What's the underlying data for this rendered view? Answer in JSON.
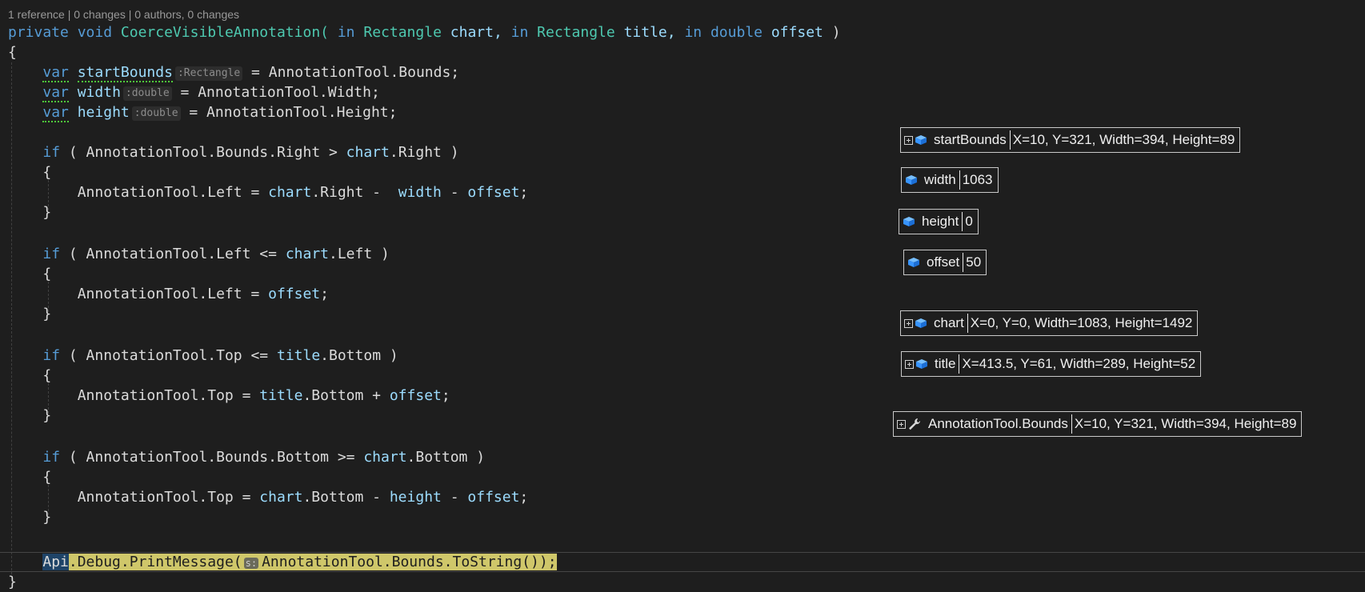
{
  "codelens": "1 reference | 0 changes | 0 authors, 0 changes",
  "code": {
    "sig_private": "private",
    "sig_void": "void",
    "sig_name": "CoerceVisibleAnnotation(",
    "sig_in1": "in",
    "sig_type1": "Rectangle",
    "sig_p1": "chart,",
    "sig_in2": "in",
    "sig_type2": "Rectangle",
    "sig_p2": "title,",
    "sig_in3": "in",
    "sig_type3": "double",
    "sig_p3": "offset",
    "sig_close": ")",
    "brace_open": "{",
    "brace_close": "}",
    "var": "var",
    "v1_name": "startBounds",
    "v1_hint": ":Rectangle",
    "v1_rhs": " = AnnotationTool.Bounds;",
    "v2_name": "width",
    "v2_hint": ":double",
    "v2_rhs": " = AnnotationTool.Width;",
    "v3_name": "height",
    "v3_hint": ":double",
    "v3_rhs": " = AnnotationTool.Height;",
    "if": "if",
    "if1_a": " ( AnnotationTool.Bounds.Right > ",
    "if1_b": "chart",
    "if1_c": ".Right )",
    "s1_a": "AnnotationTool.Left = ",
    "s1_b": "chart",
    "s1_c": ".Right -  ",
    "s1_d": "width",
    "s1_e": " - ",
    "s1_f": "offset",
    "s1_g": ";",
    "if2_a": " ( AnnotationTool.Left <= ",
    "if2_b": "chart",
    "if2_c": ".Left )",
    "s2_a": "AnnotationTool.Left = ",
    "s2_b": "offset",
    "s2_c": ";",
    "if3_a": " ( AnnotationTool.Top <= ",
    "if3_b": "title",
    "if3_c": ".Bottom )",
    "s3_a": "AnnotationTool.Top = ",
    "s3_b": "title",
    "s3_c": ".Bottom + ",
    "s3_d": "offset",
    "s3_e": ";",
    "if4_a": " ( AnnotationTool.Bounds.Bottom >= ",
    "if4_b": "chart",
    "if4_c": ".Bottom )",
    "s4_a": "AnnotationTool.Top = ",
    "s4_b": "chart",
    "s4_c": ".Bottom - ",
    "s4_d": "height",
    "s4_e": " - ",
    "s4_f": "offset",
    "s4_g": ";",
    "last_api": "Api",
    "last_a": ".Debug.PrintMessage(",
    "last_hint": "s:",
    "last_b": "AnnotationTool.Bounds.ToString());"
  },
  "datatips": [
    {
      "name": "startBounds",
      "value": "X=10, Y=321, Width=394, Height=89",
      "expandable": true,
      "icon": "field-cube-icon"
    },
    {
      "name": "width",
      "value": "1063",
      "expandable": false,
      "icon": "field-cube-icon"
    },
    {
      "name": "height",
      "value": "0",
      "expandable": false,
      "icon": "field-cube-icon"
    },
    {
      "name": "offset",
      "value": "50",
      "expandable": false,
      "icon": "field-cube-icon"
    },
    {
      "name": "chart",
      "value": "X=0, Y=0, Width=1083, Height=1492",
      "expandable": true,
      "icon": "field-cube-icon"
    },
    {
      "name": "title",
      "value": "X=413.5, Y=61, Width=289, Height=52",
      "expandable": true,
      "icon": "field-cube-icon"
    },
    {
      "name": "AnnotationTool.Bounds",
      "value": "X=10, Y=321, Width=394, Height=89",
      "expandable": true,
      "icon": "wrench-icon"
    }
  ]
}
